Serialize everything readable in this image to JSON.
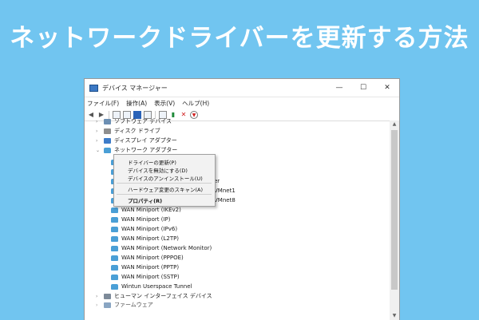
{
  "headline": "ネットワークドライバーを更新する方法",
  "window": {
    "title": "デバイス マネージャー",
    "controls": {
      "minimize": "—",
      "maximize": "☐",
      "close": "✕"
    }
  },
  "menubar": {
    "items": [
      "ファイル(F)",
      "操作(A)",
      "表示(V)",
      "ヘルプ(H)"
    ]
  },
  "toolbar": {
    "icons": [
      "back-arrow-icon",
      "forward-arrow-icon",
      "properties-icon",
      "show-hidden-icon",
      "help-icon",
      "view-icon",
      "monitor-icon",
      "update-driver-icon",
      "uninstall-icon",
      "download-icon"
    ]
  },
  "tree": {
    "categories": {
      "software": "ソフトウェア デバイス",
      "disk": "ディスク ドライブ",
      "display": "ディスプレイ アダプター",
      "network": "ネットワーク アダプター",
      "hid": "ヒューマン インターフェイス デバイス",
      "next": "ファームウェア"
    },
    "network_items": [
      "WAN Miniport (IKEv2)",
      "WAN Miniport (IP)",
      "WAN Miniport (IPv6)",
      "WAN Miniport (L2TP)",
      "WAN Miniport (Network Monitor)",
      "WAN Miniport (PPPOE)",
      "WAN Miniport (PPTP)",
      "WAN Miniport (SSTP)",
      "Wintun Userspace Tunnel"
    ],
    "partial_texts": [
      "er",
      "VMnet1",
      "VMnet8"
    ]
  },
  "context_menu": {
    "update_driver": "ドライバーの更新(P)",
    "disable_device": "デバイスを無効にする(D)",
    "uninstall_device": "デバイスのアンインストール(U)",
    "scan_hardware": "ハードウェア変更のスキャン(A)",
    "properties": "プロパティ(R)"
  },
  "colors": {
    "background": "#71c5f0",
    "headline": "#ffffff",
    "network_icon": "#4a9fd6"
  }
}
